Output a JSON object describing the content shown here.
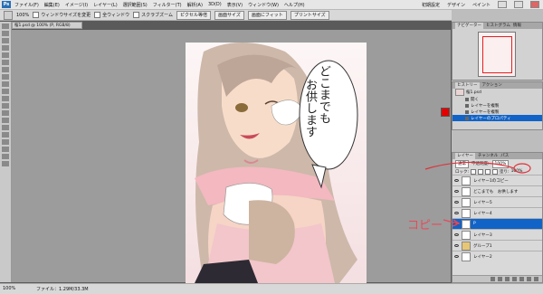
{
  "menubar": {
    "logo": "Ps",
    "menus": [
      "ファイル(F)",
      "編集(E)",
      "イメージ(I)",
      "レイヤー(L)",
      "選択範囲(S)",
      "フィルター(T)",
      "解析(A)",
      "3D(D)",
      "表示(V)",
      "ウィンドウ(W)",
      "ヘルプ(H)"
    ],
    "workspace": [
      "初期設定",
      "デザイン",
      "ペイント"
    ]
  },
  "options": {
    "zoom_label": "100%",
    "check_resize": "ウィンドウサイズを変更",
    "check_allwin": "全ウィンドウ",
    "check_scrubby": "スクラブズーム",
    "btn_actual": "ピクセル等倍",
    "btn_fit": "画面サイズ",
    "btn_fill": "画面にフィット",
    "btn_print": "プリントサイズ"
  },
  "document": {
    "tab_title": "桜1.psd @ 100% (P, RGB/8)",
    "speech_lines": [
      "どこまでも",
      "お供します"
    ]
  },
  "status": {
    "zoom": "100%",
    "info": "ファイル：1.29M/33.3M"
  },
  "navigator": {
    "tabs": [
      "ナビゲーター",
      "ヒストグラム",
      "情報"
    ],
    "active_tab": 0
  },
  "history": {
    "tabs": [
      "ヒストリー",
      "アクション"
    ],
    "source": "桜1.psd",
    "items": [
      {
        "label": "開く",
        "selected": false
      },
      {
        "label": "レイヤーを複製",
        "selected": false
      },
      {
        "label": "レイヤーを複製",
        "selected": false
      },
      {
        "label": "レイヤーのプロパティ",
        "selected": true
      }
    ]
  },
  "layers": {
    "tabs": [
      "レイヤー",
      "チャンネル",
      "パス"
    ],
    "blend_mode": "通常",
    "opacity_label": "不透明度:",
    "opacity": "100%",
    "lock_label": "ロック:",
    "fill_label": "塗り:",
    "fill": "100%",
    "rows": [
      {
        "name": "レイヤー1のコピー",
        "selected": false,
        "group": false
      },
      {
        "name": "どこまでも　お供します",
        "selected": false,
        "group": false
      },
      {
        "name": "レイヤー5",
        "selected": false,
        "group": false
      },
      {
        "name": "レイヤー4",
        "selected": false,
        "group": false
      },
      {
        "name": "P",
        "selected": true,
        "group": false
      },
      {
        "name": "レイヤー3",
        "selected": false,
        "group": false
      },
      {
        "name": "グループ1",
        "selected": false,
        "group": true
      },
      {
        "name": "レイヤー2",
        "selected": false,
        "group": false
      }
    ]
  },
  "annotation": {
    "label": "コピー",
    "color": "#e64a5a"
  },
  "colors": {
    "foreground": "#e40000",
    "selection": "#1163c7"
  }
}
